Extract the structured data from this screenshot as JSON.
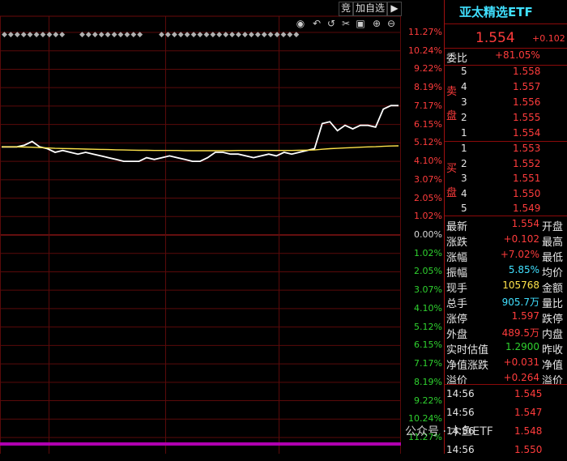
{
  "toolbar": {
    "bid_label": "竞",
    "add_fav_label": "加自选",
    "collapse_icon": "panel-collapse-icon",
    "tool_icons": [
      "eye-icon",
      "undo-icon",
      "scissors-icon",
      "lock-icon",
      "zoom-in-icon",
      "zoom-out-icon"
    ]
  },
  "quote": {
    "name": "亚太精选ETF",
    "price": "1.554",
    "change": "+0.102",
    "weibi_label": "委比",
    "weibi_value": "+81.05%"
  },
  "order_book": {
    "sell_label_1": "卖",
    "sell_label_2": "盘",
    "buy_label_1": "买",
    "buy_label_2": "盘",
    "sell": [
      {
        "level": "5",
        "price": "1.558"
      },
      {
        "level": "4",
        "price": "1.557"
      },
      {
        "level": "3",
        "price": "1.556"
      },
      {
        "level": "2",
        "price": "1.555"
      },
      {
        "level": "1",
        "price": "1.554"
      }
    ],
    "buy": [
      {
        "level": "1",
        "price": "1.553"
      },
      {
        "level": "2",
        "price": "1.552"
      },
      {
        "level": "3",
        "price": "1.551"
      },
      {
        "level": "4",
        "price": "1.550"
      },
      {
        "level": "5",
        "price": "1.549"
      }
    ]
  },
  "stats": [
    {
      "label": "最新",
      "value": "1.554",
      "color": "red",
      "label2": "开盘"
    },
    {
      "label": "涨跌",
      "value": "+0.102",
      "color": "red",
      "label2": "最高"
    },
    {
      "label": "涨幅",
      "value": "+7.02%",
      "color": "red",
      "label2": "最低"
    },
    {
      "label": "振幅",
      "value": "5.85%",
      "color": "cyan",
      "label2": "均价"
    },
    {
      "label": "现手",
      "value": "105768",
      "color": "yellow",
      "label2": "金额"
    },
    {
      "label": "总手",
      "value": "905.7万",
      "color": "cyan",
      "label2": "量比"
    },
    {
      "label": "涨停",
      "value": "1.597",
      "color": "red",
      "label2": "跌停"
    },
    {
      "label": "外盘",
      "value": "489.5万",
      "color": "red",
      "label2": "内盘"
    },
    {
      "label": "实时估值",
      "value": "1.2900",
      "color": "green",
      "label2": "昨收"
    },
    {
      "label": "净值涨跌",
      "value": "+0.031",
      "color": "red",
      "label2": "净值"
    },
    {
      "label": "溢价",
      "value": "+0.264",
      "color": "red",
      "label2": "溢价"
    }
  ],
  "ticks": [
    {
      "time": "14:56",
      "price": "1.545"
    },
    {
      "time": "14:56",
      "price": "1.547"
    },
    {
      "time": "14:56",
      "price": "1.548"
    },
    {
      "time": "14:56",
      "price": "1.550"
    }
  ],
  "axis": {
    "pct_labels": [
      "11.27%",
      "10.24%",
      "9.22%",
      "8.19%",
      "7.17%",
      "6.15%",
      "5.12%",
      "4.10%",
      "3.07%",
      "2.05%",
      "1.02%",
      "0.00%",
      "1.02%",
      "2.05%",
      "3.07%",
      "4.10%",
      "5.12%",
      "6.15%",
      "7.17%",
      "8.19%",
      "9.22%",
      "10.24%",
      "11.27%"
    ]
  },
  "chart_data": {
    "type": "line",
    "y_unit": "%",
    "ylim": [
      -11.27,
      11.27
    ],
    "series": [
      {
        "values": [
          4.9,
          4.9,
          4.9,
          5.0,
          5.2,
          4.9,
          4.8,
          4.6,
          4.7,
          4.6,
          4.5,
          4.6,
          4.5,
          4.4,
          4.3,
          4.2,
          4.1,
          4.1,
          4.1,
          4.3,
          4.2,
          4.3,
          4.4,
          4.3,
          4.2,
          4.1,
          4.1,
          4.3,
          4.6,
          4.6,
          4.5,
          4.5,
          4.4,
          4.3,
          4.4,
          4.5,
          4.4,
          4.6,
          4.5,
          4.6,
          4.7,
          4.8,
          6.2,
          6.3,
          5.8,
          6.1,
          5.9,
          6.1,
          6.1,
          6.0,
          7.0,
          7.2,
          7.2
        ]
      },
      {
        "values": [
          4.9,
          4.9,
          4.9,
          4.89,
          4.88,
          4.86,
          4.84,
          4.82,
          4.81,
          4.8,
          4.79,
          4.78,
          4.77,
          4.76,
          4.75,
          4.74,
          4.73,
          4.72,
          4.71,
          4.71,
          4.7,
          4.7,
          4.7,
          4.7,
          4.69,
          4.69,
          4.69,
          4.69,
          4.69,
          4.69,
          4.69,
          4.7,
          4.7,
          4.7,
          4.7,
          4.7,
          4.7,
          4.7,
          4.7,
          4.71,
          4.72,
          4.73,
          4.77,
          4.8,
          4.82,
          4.84,
          4.86,
          4.88,
          4.9,
          4.91,
          4.93,
          4.95,
          4.96
        ]
      }
    ],
    "series_colors": [
      "#ffffff",
      "#ffe34a"
    ]
  },
  "watermark": "公众号 · 木鱼ETF"
}
